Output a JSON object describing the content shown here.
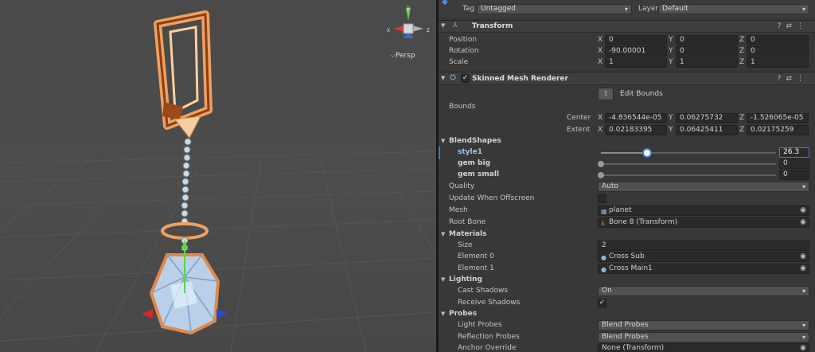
{
  "scene": {
    "projection_label": "Persp",
    "gizmo_axes": {
      "x": "x",
      "z": "z",
      "y": "y"
    }
  },
  "inspector": {
    "top_bar": {
      "tag_label": "Tag",
      "tag_value": "Untagged",
      "layer_label": "Layer",
      "layer_value": "Default"
    },
    "transform": {
      "title": "Transform",
      "rows": [
        {
          "label": "Position",
          "x": "0",
          "y": "0",
          "z": "0"
        },
        {
          "label": "Rotation",
          "x": "-90.00001",
          "y": "0",
          "z": "0"
        },
        {
          "label": "Scale",
          "x": "1",
          "y": "1",
          "z": "1"
        }
      ],
      "axis_letters": [
        "X",
        "Y",
        "Z"
      ]
    },
    "smr": {
      "title": "Skinned Mesh Renderer",
      "edit_bounds_label": "Edit Bounds",
      "bounds_label": "Bounds",
      "center": {
        "label": "Center",
        "x": "-4.836544e-05",
        "y": "0.06275732",
        "z": "-1.526065e-05"
      },
      "extent": {
        "label": "Extent",
        "x": "0.02183395",
        "y": "0.06425411",
        "z": "0.02175259"
      },
      "blendshapes": {
        "label": "BlendShapes",
        "items": [
          {
            "label": "style1",
            "value": "26.3",
            "level": 0.263
          },
          {
            "label": "gem big",
            "value": "0",
            "level": 0
          },
          {
            "label": "gem small",
            "value": "0",
            "level": 0
          }
        ]
      },
      "quality": {
        "label": "Quality",
        "value": "Auto"
      },
      "update_offscreen": {
        "label": "Update When Offscreen",
        "checked": false
      },
      "mesh": {
        "label": "Mesh",
        "value": "planet"
      },
      "root_bone": {
        "label": "Root Bone",
        "value": "Bone 8 (Transform)"
      },
      "materials": {
        "label": "Materials",
        "size_label": "Size",
        "size_value": "2",
        "elements": [
          {
            "label": "Element 0",
            "value": "Cross Sub"
          },
          {
            "label": "Element 1",
            "value": "Cross Main1"
          }
        ]
      },
      "lighting": {
        "label": "Lighting",
        "cast_shadows": {
          "label": "Cast Shadows",
          "value": "On"
        },
        "receive_shadows": {
          "label": "Receive Shadows",
          "checked": true
        }
      },
      "probes": {
        "label": "Probes",
        "light_probes": {
          "label": "Light Probes",
          "value": "Blend Probes"
        },
        "reflection_probes": {
          "label": "Reflection Probes",
          "value": "Blend Probes"
        },
        "anchor_override": {
          "label": "Anchor Override",
          "value": "None (Transform)"
        }
      }
    }
  },
  "colors": {
    "accent": "#3a7bd5",
    "copper": "#e08a4a"
  }
}
